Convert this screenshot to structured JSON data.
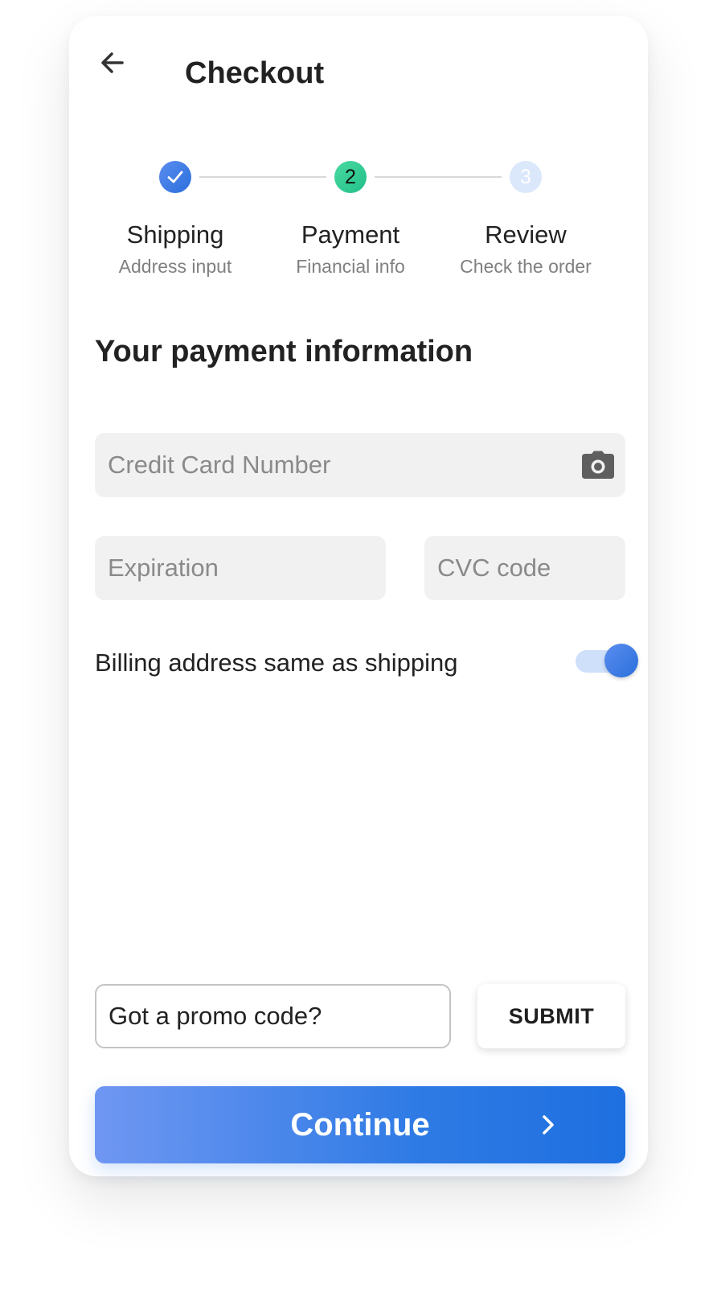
{
  "header": {
    "title": "Checkout",
    "back_icon": "arrow-left-icon"
  },
  "stepper": {
    "steps": [
      {
        "label": "Shipping",
        "sublabel": "Address input",
        "status": "completed",
        "marker": "",
        "icon": "check-icon"
      },
      {
        "label": "Payment",
        "sublabel": "Financial info",
        "status": "active",
        "marker": "2"
      },
      {
        "label": "Review",
        "sublabel": "Check the order",
        "status": "upcoming",
        "marker": "3"
      }
    ]
  },
  "payment": {
    "heading": "Your payment information",
    "card_number": {
      "placeholder": "Credit Card Number",
      "value": "",
      "icon": "camera-icon"
    },
    "expiration": {
      "placeholder": "Expiration",
      "value": ""
    },
    "cvc": {
      "placeholder": "CVC code",
      "value": ""
    },
    "billing_toggle": {
      "label": "Billing address same as shipping",
      "on": true
    }
  },
  "promo": {
    "placeholder": "Got a promo code?",
    "value": "",
    "submit_label": "SUBMIT"
  },
  "footer": {
    "continue_label": "Continue",
    "continue_icon": "chevron-right-icon"
  },
  "colors": {
    "accent_blue": "#2a6fdb",
    "active_green": "#22c08a",
    "upcoming_step": "#dbe7fb",
    "field_bg": "#f1f1f1"
  }
}
